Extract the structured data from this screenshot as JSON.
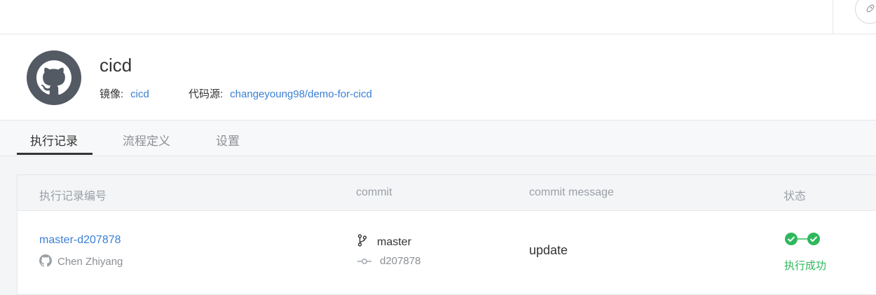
{
  "repo": {
    "name": "cicd",
    "image_label": "镜像:",
    "image_value": "cicd",
    "source_label": "代码源:",
    "source_value": "changeyoung98/demo-for-cicd"
  },
  "tabs": [
    {
      "label": "执行记录",
      "active": true
    },
    {
      "label": "流程定义",
      "active": false
    },
    {
      "label": "设置",
      "active": false
    }
  ],
  "table": {
    "headers": [
      "执行记录编号",
      "commit",
      "commit message",
      "状态"
    ],
    "rows": [
      {
        "run_id": "master-d207878",
        "author": "Chen Zhiyang",
        "branch": "master",
        "commit": "d207878",
        "message": "update",
        "status": "执行成功"
      }
    ]
  },
  "colors": {
    "link": "#3a7fd5",
    "success": "#2eb85c"
  }
}
